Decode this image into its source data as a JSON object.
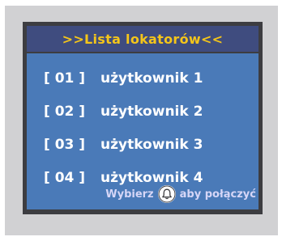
{
  "header": {
    "title": ">>Lista lokatorów<<"
  },
  "list": {
    "items": [
      {
        "number": "[ 01 ]",
        "label": "użytkownik 1"
      },
      {
        "number": "[ 02 ]",
        "label": "użytkownik 2"
      },
      {
        "number": "[ 03 ]",
        "label": "użytkownik 3"
      },
      {
        "number": "[ 04 ]",
        "label": "użytkownik 4"
      }
    ]
  },
  "footer": {
    "before_icon": "Wybierz",
    "icon": "bell-icon",
    "after_icon": "aby połączyć"
  },
  "colors": {
    "title_text": "#f4c51a",
    "title_bar": "#3f4c7f",
    "content_bg": "#4a7ab8",
    "frame": "#3d3d41",
    "bezel": "#d1d1d3"
  }
}
